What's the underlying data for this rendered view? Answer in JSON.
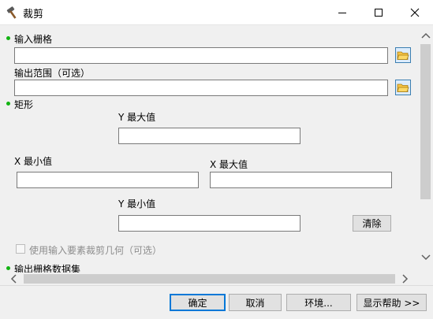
{
  "window": {
    "title": "裁剪"
  },
  "form": {
    "input_raster_label": "输入栅格",
    "input_raster_value": "",
    "output_extent_label": "输出范围（可选）",
    "output_extent_value": "",
    "rectangle_label": "矩形",
    "y_max_label": "Y 最大值",
    "y_max_value": "",
    "x_min_label": "X 最小值",
    "x_min_value": "",
    "x_max_label": "X 最大值",
    "x_max_value": "",
    "y_min_label": "Y 最小值",
    "y_min_value": "",
    "clear_label": "清除",
    "use_features_label": "使用输入要素裁剪几何（可选）",
    "output_dataset_label": "输出栅格数据集"
  },
  "footer": {
    "ok_label": "确定",
    "cancel_label": "取消",
    "env_label": "环境...",
    "help_label": "显示帮助 >>"
  },
  "colors": {
    "required_bullet": "#12b312",
    "primary_border": "#0078d7"
  },
  "icons": {
    "app": "hammer-icon",
    "browse": "open-folder-icon"
  }
}
